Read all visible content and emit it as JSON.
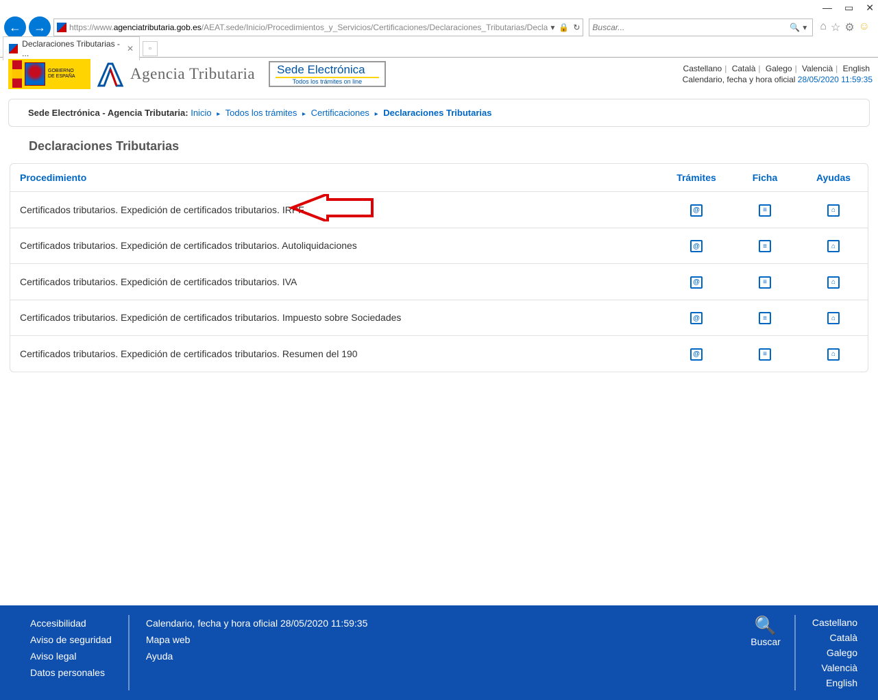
{
  "browser": {
    "url_prefix": "https://",
    "url_sub": "www.",
    "url_domain": "agenciatributaria.gob.es",
    "url_path": "/AEAT.sede/Inicio/Procedimientos_y_Servicios/Certificaciones/Declaraciones_Tributarias/Decla",
    "search_placeholder": "Buscar...",
    "tab_title": "Declaraciones Tributarias - ..."
  },
  "header": {
    "gob_text": "GOBIERNO\nDE ESPAÑA",
    "agency": "Agencia Tributaria",
    "sede_title": "Sede Electrónica",
    "sede_sub": "Todos los trámites on line",
    "langs": [
      "Castellano",
      "Català",
      "Galego",
      "Valencià",
      "English"
    ],
    "date_label": "Calendario, fecha y hora oficial",
    "date_value": "28/05/2020 11:59:35"
  },
  "breadcrumb": {
    "prefix": "Sede Electrónica - Agencia Tributaria:",
    "items": [
      "Inicio",
      "Todos los trámites",
      "Certificaciones"
    ],
    "current": "Declaraciones Tributarias"
  },
  "page_title": "Declaraciones Tributarias",
  "table": {
    "headers": {
      "proc": "Procedimiento",
      "tramites": "Trámites",
      "ficha": "Ficha",
      "ayudas": "Ayudas"
    },
    "rows": [
      {
        "name": "Certificados tributarios. Expedición de certificados tributarios. IRPF"
      },
      {
        "name": "Certificados tributarios. Expedición de certificados tributarios. Autoliquidaciones"
      },
      {
        "name": "Certificados tributarios. Expedición de certificados tributarios. IVA"
      },
      {
        "name": "Certificados tributarios. Expedición de certificados tributarios. Impuesto sobre Sociedades"
      },
      {
        "name": "Certificados tributarios. Expedición de certificados tributarios. Resumen del 190"
      }
    ]
  },
  "footer": {
    "col1": [
      "Accesibilidad",
      "Aviso de seguridad",
      "Aviso legal",
      "Datos personales"
    ],
    "col2_date": "Calendario, fecha y hora oficial 28/05/2020 11:59:35",
    "col2": [
      "Mapa web",
      "Ayuda"
    ],
    "search": "Buscar",
    "langs": [
      "Castellano",
      "Català",
      "Galego",
      "Valencià",
      "English"
    ]
  }
}
